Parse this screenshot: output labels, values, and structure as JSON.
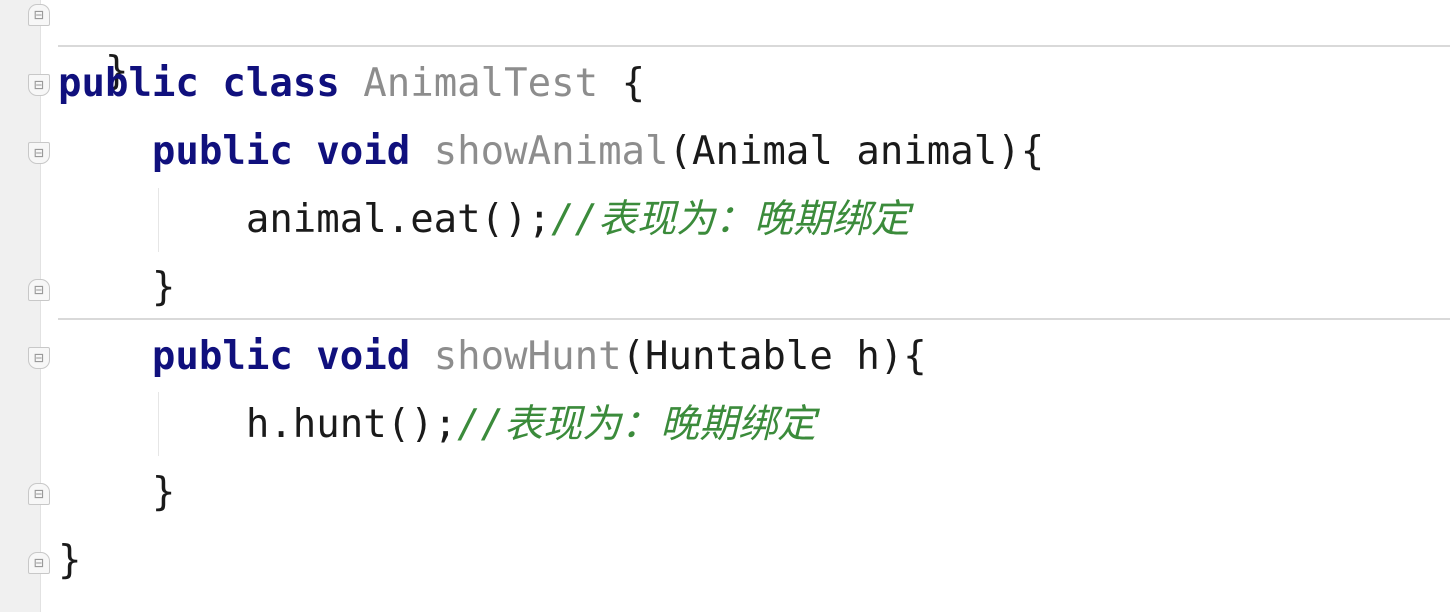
{
  "gutter": {
    "fold_open_glyph": "⊟",
    "fold_close_glyph": "⊟"
  },
  "code": {
    "line0": {
      "brace": "}"
    },
    "line1": {
      "kw_public": "public",
      "kw_class": "class",
      "class_name": "AnimalTest",
      "open_brace": "{"
    },
    "line2": {
      "kw_public": "public",
      "kw_void": "void",
      "method_name": "showAnimal",
      "params": "(Animal animal){"
    },
    "line3": {
      "code": "animal.eat();",
      "comment": "//表现为：晚期绑定"
    },
    "line4": {
      "brace": "}"
    },
    "line5": {
      "kw_public": "public",
      "kw_void": "void",
      "method_name": "showHunt",
      "params": "(Huntable h){"
    },
    "line6": {
      "code": "h.hunt();",
      "comment": "//表现为：晚期绑定"
    },
    "line7": {
      "brace": "}"
    },
    "line8": {
      "brace": "}"
    }
  },
  "colors": {
    "keyword": "#10107d",
    "declaration_name": "#8d8d8d",
    "comment": "#3b8b3b",
    "text": "#1a1a1a",
    "gutter_bg": "#f0f0f0"
  }
}
